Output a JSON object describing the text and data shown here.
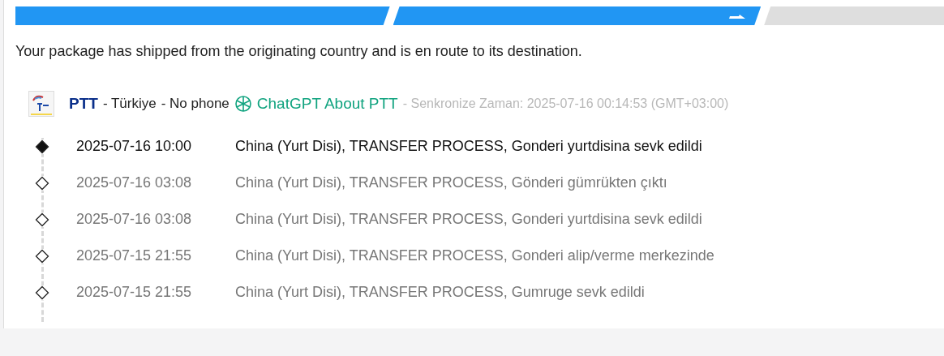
{
  "progress": {
    "steps": [
      {
        "done": true
      },
      {
        "done": true,
        "current": true
      },
      {
        "done": false
      }
    ]
  },
  "status_message": "Your package has shipped from the originating country and is en route to its destination.",
  "carrier": {
    "name": "PTT",
    "country": "- Türkiye",
    "phone": "- No phone",
    "chatgpt_link": "ChatGPT About PTT",
    "sync_time": "- Senkronize Zaman: 2025-07-16 00:14:53 (GMT+03:00)"
  },
  "events": [
    {
      "time": "2025-07-16 10:00",
      "description": "China (Yurt Disi), TRANSFER PROCESS, Gonderi yurtdisina sevk edildi",
      "latest": true
    },
    {
      "time": "2025-07-16 03:08",
      "description": "China (Yurt Disi), TRANSFER PROCESS, Gönderi gümrükten çıktı",
      "latest": false
    },
    {
      "time": "2025-07-16 03:08",
      "description": "China (Yurt Disi), TRANSFER PROCESS, Gonderi yurtdisina sevk edildi",
      "latest": false
    },
    {
      "time": "2025-07-15 21:55",
      "description": "China (Yurt Disi), TRANSFER PROCESS, Gonderi alip/verme merkezinde",
      "latest": false
    },
    {
      "time": "2025-07-15 21:55",
      "description": "China (Yurt Disi), TRANSFER PROCESS, Gumruge sevk edildi",
      "latest": false
    }
  ]
}
